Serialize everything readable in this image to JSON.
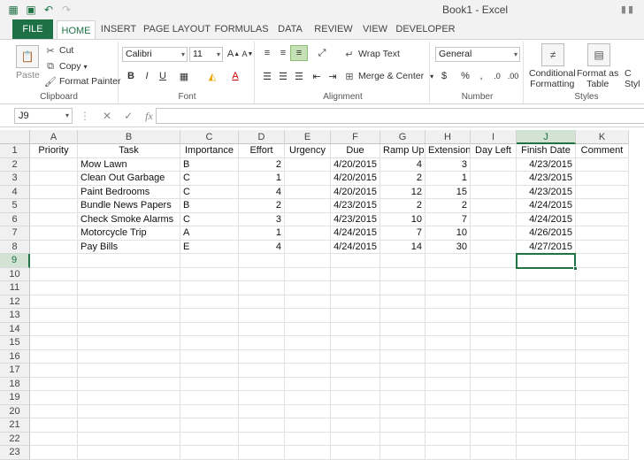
{
  "qat": {
    "icons": [
      "excel-logo-icon",
      "save-icon",
      "undo-icon",
      "redo-icon"
    ]
  },
  "window": {
    "title": "Book1 - Excel"
  },
  "tabs": [
    "FILE",
    "HOME",
    "INSERT",
    "PAGE LAYOUT",
    "FORMULAS",
    "DATA",
    "REVIEW",
    "VIEW",
    "DEVELOPER"
  ],
  "ribbon": {
    "clipboard": {
      "paste": "Paste",
      "cut": "Cut",
      "copy": "Copy",
      "format_painter": "Format Painter",
      "label": "Clipboard"
    },
    "font": {
      "name": "Calibri",
      "size": "11",
      "bold": "B",
      "italic": "I",
      "underline": "U",
      "font_color": "A",
      "label": "Font"
    },
    "alignment": {
      "wrap_text": "Wrap Text",
      "merge_center": "Merge & Center",
      "label": "Alignment"
    },
    "number": {
      "format": "General",
      "currency": "$",
      "percent": "%",
      "comma": ",",
      "label": "Number"
    },
    "styles": {
      "conditional_1": "Conditional",
      "conditional_2": "Formatting",
      "format_table_1": "Format as",
      "format_table_2": "Table",
      "cell_styles_1": "C",
      "cell_styles_2": "Styl",
      "label": "Styles"
    }
  },
  "formula_bar": {
    "name_box": "J9",
    "cancel": "✕",
    "enter": "✓",
    "fx": "fx",
    "value": ""
  },
  "colors": {
    "accent": "#217346",
    "file_tab": "#1e7145",
    "background": "#a8c49a"
  },
  "grid": {
    "columns": [
      "A",
      "B",
      "C",
      "D",
      "E",
      "F",
      "G",
      "H",
      "I",
      "J",
      "K"
    ],
    "row_numbers": [
      "1",
      "2",
      "3",
      "4",
      "5",
      "6",
      "7",
      "8",
      "9",
      "10",
      "11",
      "12",
      "13",
      "14",
      "15",
      "16",
      "17",
      "18",
      "19",
      "20",
      "21",
      "22",
      "23"
    ],
    "selected_cell": "J9",
    "header_row": [
      "Priority",
      "Task",
      "Importance",
      "Effort",
      "Urgency",
      "Due",
      "Ramp Up",
      "Extension",
      "Day Left",
      "Finish Date",
      "Comment"
    ],
    "rows": [
      [
        "",
        "Mow Lawn",
        "B",
        "2",
        "",
        "4/20/2015",
        "4",
        "3",
        "",
        "4/23/2015",
        ""
      ],
      [
        "",
        "Clean Out Garbage",
        "C",
        "1",
        "",
        "4/20/2015",
        "2",
        "1",
        "",
        "4/23/2015",
        ""
      ],
      [
        "",
        "Paint Bedrooms",
        "C",
        "4",
        "",
        "4/20/2015",
        "12",
        "15",
        "",
        "4/23/2015",
        ""
      ],
      [
        "",
        "Bundle News Papers",
        "B",
        "2",
        "",
        "4/23/2015",
        "2",
        "2",
        "",
        "4/24/2015",
        ""
      ],
      [
        "",
        "Check Smoke Alarms",
        "C",
        "3",
        "",
        "4/23/2015",
        "10",
        "7",
        "",
        "4/24/2015",
        ""
      ],
      [
        "",
        "Motorcycle Trip",
        "A",
        "1",
        "",
        "4/24/2015",
        "7",
        "10",
        "",
        "4/26/2015",
        ""
      ],
      [
        "",
        "Pay Bills",
        "E",
        "4",
        "",
        "4/24/2015",
        "14",
        "30",
        "",
        "4/27/2015",
        ""
      ]
    ]
  }
}
